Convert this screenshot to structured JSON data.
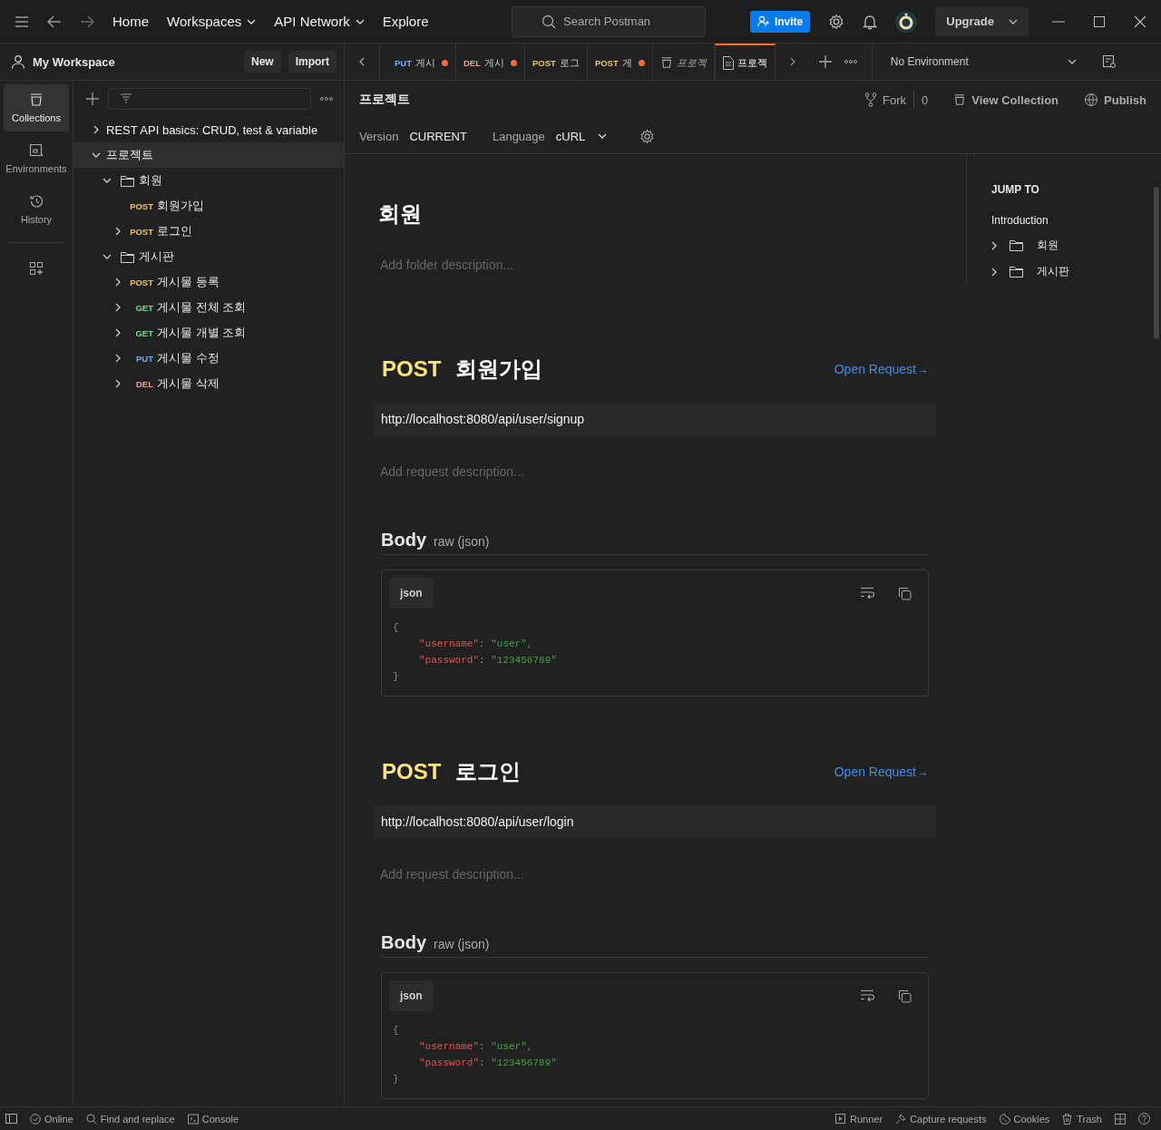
{
  "topbar": {
    "nav": [
      {
        "label": "Home",
        "dropdown": false
      },
      {
        "label": "Workspaces",
        "dropdown": true
      },
      {
        "label": "API Network",
        "dropdown": true
      },
      {
        "label": "Explore",
        "dropdown": false
      }
    ],
    "search": {
      "placeholder": "Search Postman"
    },
    "invite": "Invite",
    "upgrade": "Upgrade"
  },
  "workspace": {
    "name": "My Workspace",
    "buttons": [
      "New",
      "Import"
    ]
  },
  "rail": [
    {
      "label": "Collections",
      "selected": true
    },
    {
      "label": "Environments",
      "selected": false
    },
    {
      "label": "History",
      "selected": false
    }
  ],
  "tree": [
    {
      "kind": "collection",
      "name": "REST API basics: CRUD, test & variable",
      "expanded": false,
      "selected": false
    },
    {
      "kind": "collection",
      "name": "프로젝트",
      "expanded": true,
      "selected": true,
      "children": [
        {
          "kind": "folder",
          "name": "회원",
          "expanded": true,
          "selected": false,
          "children": [
            {
              "kind": "request",
              "method": "POST",
              "color": "#e9c46a",
              "name": "회원가입",
              "selected": false
            },
            {
              "kind": "request",
              "method": "POST",
              "color": "#e9c46a",
              "name": "로그인",
              "expanded": false,
              "selected": false
            }
          ]
        },
        {
          "kind": "folder",
          "name": "게시판",
          "expanded": true,
          "selected": false,
          "children": [
            {
              "kind": "request",
              "method": "POST",
              "color": "#e9c46a",
              "name": "게시물 등록",
              "expanded": false,
              "selected": false
            },
            {
              "kind": "request",
              "method": "GET",
              "color": "#6bdd9a",
              "name": "게시물 전체 조회",
              "expanded": false,
              "selected": false
            },
            {
              "kind": "request",
              "method": "GET",
              "color": "#6bdd9a",
              "name": "게시물 개별 조회",
              "expanded": false,
              "selected": false
            },
            {
              "kind": "request",
              "method": "PUT",
              "color": "#74aef6",
              "name": "게시물 수정",
              "expanded": false,
              "selected": false
            },
            {
              "kind": "request",
              "method": "DEL",
              "color": "#f79a8e",
              "name": "게시물 삭제",
              "expanded": false,
              "selected": false
            }
          ]
        }
      ]
    }
  ],
  "tabs": [
    {
      "kind": "request",
      "method": "PUT",
      "color": "#74aef6",
      "label": "게시",
      "unsaved": true,
      "selected": false
    },
    {
      "kind": "request",
      "method": "DEL",
      "color": "#f79a8e",
      "label": "게시",
      "unsaved": true,
      "selected": false
    },
    {
      "kind": "request",
      "method": "POST",
      "color": "#e9c46a",
      "label": "로그",
      "unsaved": false,
      "selected": false
    },
    {
      "kind": "request",
      "method": "POST",
      "color": "#e9c46a",
      "label": "게",
      "unsaved": true,
      "selected": false
    },
    {
      "kind": "collection",
      "label": "프로젝",
      "unsaved": false,
      "selected": false
    },
    {
      "kind": "documentation",
      "label": "프로젝",
      "unsaved": false,
      "selected": true
    }
  ],
  "environment": "No Environment",
  "doc": {
    "title": "프로젝트",
    "fork": "Fork",
    "fork_count": "0",
    "view_collection": "View Collection",
    "publish": "Publish",
    "version_label": "Version",
    "version": "CURRENT",
    "language_label": "Language",
    "language": "cURL",
    "folder": {
      "name": "회원",
      "description_placeholder": "Add folder description..."
    },
    "requests": [
      {
        "method": "POST",
        "color": "#ffe47e",
        "name": "회원가입",
        "open": "Open Request→",
        "url": "http://localhost:8080/api/user/signup",
        "description_placeholder": "Add request description...",
        "body_title": "Body",
        "body_type": "raw (json)",
        "lang": "json",
        "code": [
          [
            {
              "kind": "punct",
              "t": "{"
            }
          ],
          [
            {
              "kind": "key",
              "t": "\"username\""
            },
            {
              "kind": "punct",
              "t": ": "
            },
            {
              "kind": "string",
              "t": "\"user\""
            },
            {
              "kind": "punct",
              "t": ","
            }
          ],
          [
            {
              "kind": "key",
              "t": "\"password\""
            },
            {
              "kind": "punct",
              "t": ": "
            },
            {
              "kind": "string",
              "t": "\"123456789\""
            }
          ],
          [
            {
              "kind": "punct",
              "t": "}"
            }
          ]
        ]
      },
      {
        "method": "POST",
        "color": "#ffe47e",
        "name": "로그인",
        "open": "Open Request→",
        "url": "http://localhost:8080/api/user/login",
        "description_placeholder": "Add request description...",
        "body_title": "Body",
        "body_type": "raw (json)",
        "lang": "json",
        "code": [
          [
            {
              "kind": "punct",
              "t": "{"
            }
          ],
          [
            {
              "kind": "key",
              "t": "\"username\""
            },
            {
              "kind": "punct",
              "t": ": "
            },
            {
              "kind": "string",
              "t": "\"user\""
            },
            {
              "kind": "punct",
              "t": ","
            }
          ],
          [
            {
              "kind": "key",
              "t": "\"password\""
            },
            {
              "kind": "punct",
              "t": ": "
            },
            {
              "kind": "string",
              "t": "\"123456789\""
            }
          ],
          [
            {
              "kind": "punct",
              "t": "}"
            }
          ]
        ]
      }
    ],
    "jump": {
      "title": "JUMP TO",
      "intro": "Introduction",
      "folders": [
        {
          "name": "회원",
          "expanded": false
        },
        {
          "name": "게시판",
          "expanded": false
        }
      ]
    }
  },
  "status": {
    "left": [
      "Online",
      "Find and replace",
      "Console"
    ],
    "right": [
      "Runner",
      "Capture requests",
      "Cookies",
      "Trash"
    ]
  }
}
